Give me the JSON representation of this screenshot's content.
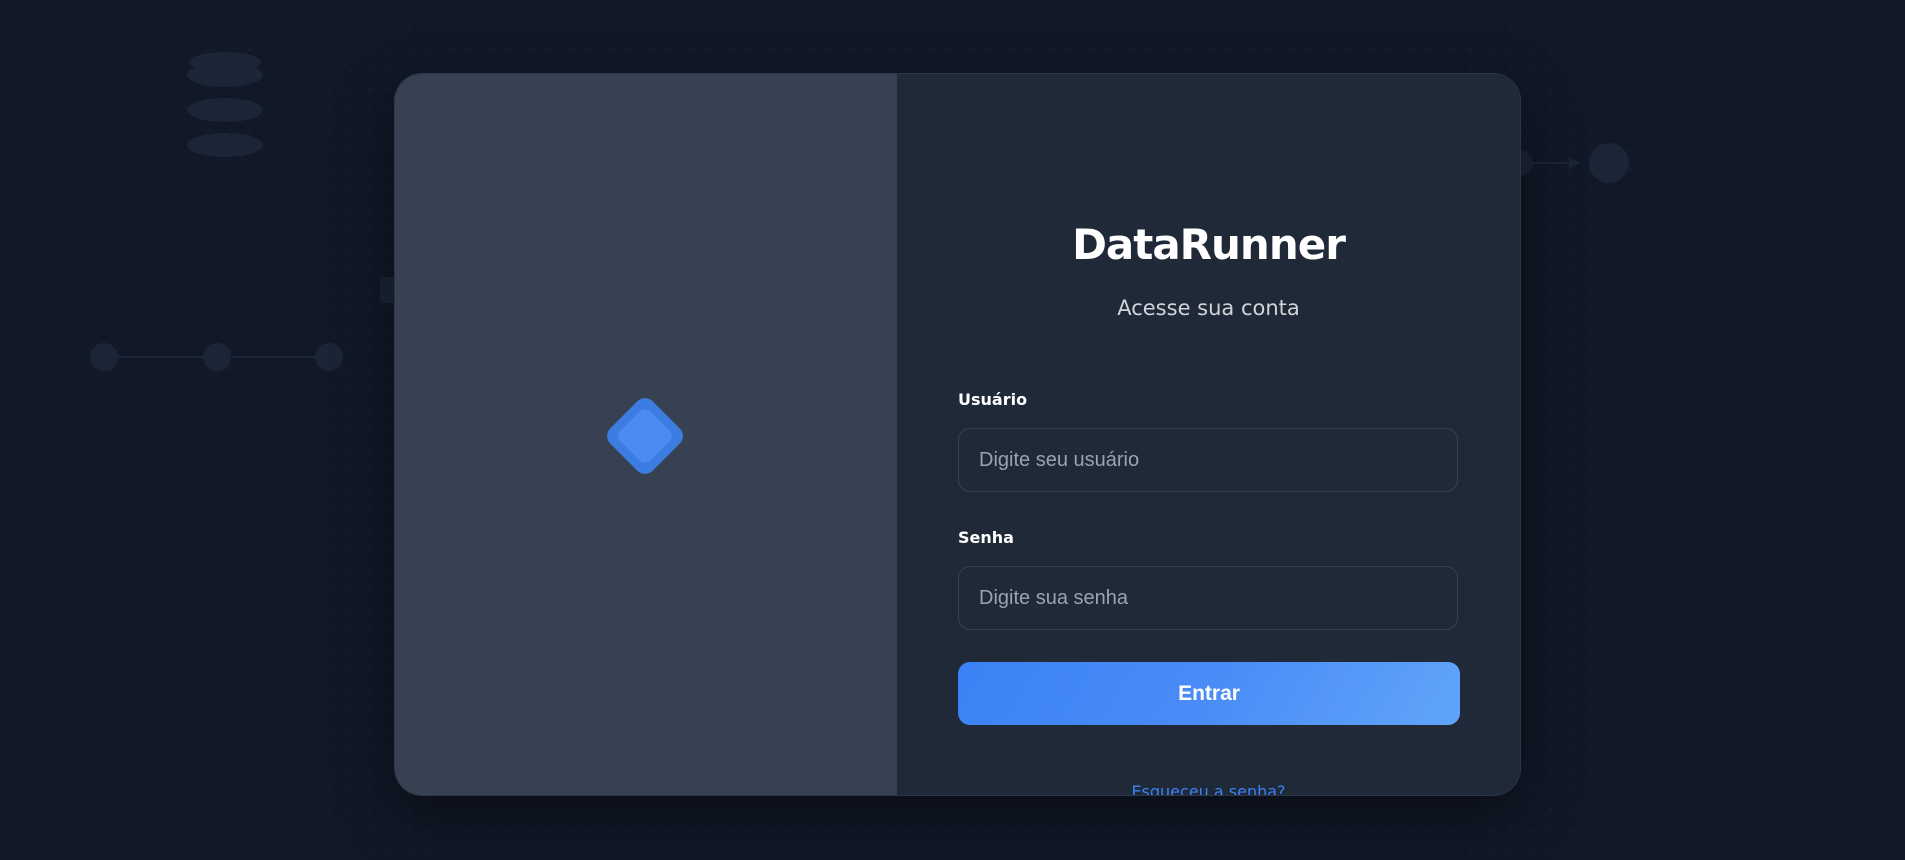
{
  "app": {
    "title": "DataRunner",
    "subtitle": "Acesse sua conta"
  },
  "form": {
    "username": {
      "label": "Usuário",
      "placeholder": "Digite seu usuário",
      "value": ""
    },
    "password": {
      "label": "Senha",
      "placeholder": "Digite sua senha",
      "value": ""
    },
    "submit_label": "Entrar",
    "forgot_label": "Esqueceu a senha?"
  },
  "icons": {
    "brand": "diamond-logo-icon"
  },
  "colors": {
    "page_background": "#111827",
    "brand_panel": "#374151",
    "form_panel": "#1f2937",
    "accent": "#3b82f6",
    "accent_light": "#60a5fa",
    "text_primary": "#ffffff",
    "text_secondary": "#d1d5db",
    "placeholder": "#9ca3af"
  }
}
